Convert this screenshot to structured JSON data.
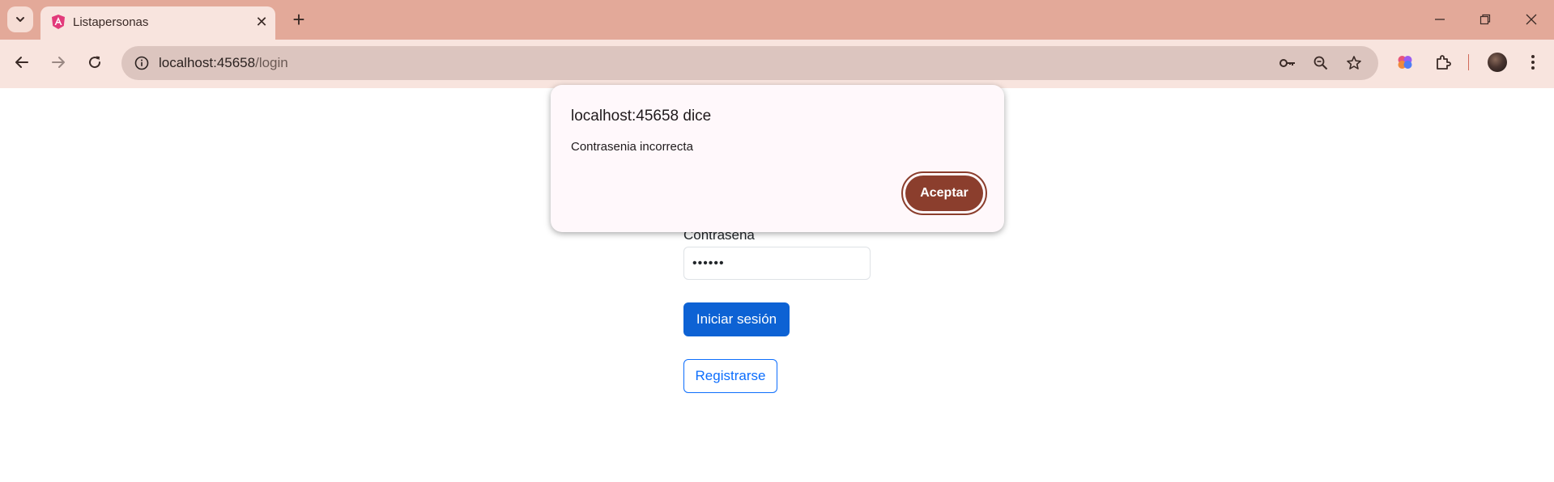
{
  "browser": {
    "tab": {
      "title": "Listapersonas"
    },
    "address_bar": {
      "host": "localhost:45658",
      "path": "/login"
    }
  },
  "login_form": {
    "password_label": "Contrasena",
    "password_value": "••••••",
    "submit_label": "Iniciar sesión",
    "register_label": "Registrarse"
  },
  "alert_dialog": {
    "title": "localhost:45658 dice",
    "message": "Contrasenia incorrecta",
    "accept_label": "Aceptar"
  },
  "colors": {
    "tabstrip": "#e3a999",
    "toolbar": "#f8e4de",
    "primary_button": "#0d62d4",
    "dialog_button": "#8b3e2d"
  },
  "icons": [
    "tab-search-icon",
    "angular-favicon-icon",
    "close-icon",
    "new-tab-icon",
    "minimize-icon",
    "restore-icon",
    "window-close-icon",
    "back-arrow-icon",
    "forward-arrow-icon",
    "reload-icon",
    "site-info-icon",
    "password-key-icon",
    "zoom-icon",
    "bookmark-star-icon",
    "extension-brain-icon",
    "extensions-puzzle-icon",
    "profile-avatar",
    "menu-kebab-icon"
  ]
}
